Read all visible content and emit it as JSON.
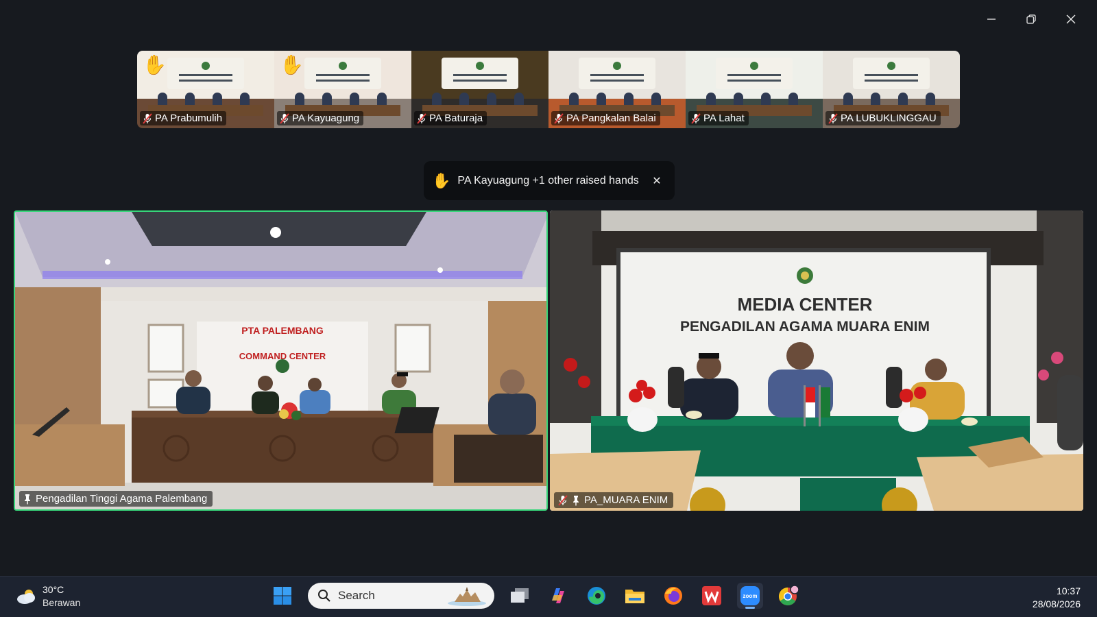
{
  "window_controls": {
    "minimize": "minimize-icon",
    "restore": "restore-icon",
    "close": "close-icon"
  },
  "thumbnails": [
    {
      "name": "PA Prabumulih",
      "hand_raised": true,
      "muted": true,
      "wall": "#f2ede4",
      "floor": "#6b4a36",
      "banner_text": ""
    },
    {
      "name": "PA Kayuagung",
      "hand_raised": true,
      "muted": true,
      "wall": "#efe6dd",
      "floor": "#8a7f77",
      "banner_text": ""
    },
    {
      "name": "PA Baturaja",
      "hand_raised": false,
      "muted": true,
      "wall": "#4a3a20",
      "floor": "#2f2c2a",
      "banner_text": ""
    },
    {
      "name": "PA Pangkalan Balai",
      "hand_raised": false,
      "muted": true,
      "wall": "#e8e4de",
      "floor": "#b85a2d",
      "banner_text": ""
    },
    {
      "name": "PA Lahat",
      "hand_raised": false,
      "muted": true,
      "wall": "#eef0ea",
      "floor": "#3d4a44",
      "banner_text": ""
    },
    {
      "name": "PA LUBUKLINGGAU",
      "hand_raised": false,
      "muted": true,
      "wall": "#e7e3dc",
      "floor": "#7a6a5e",
      "banner_text": ""
    }
  ],
  "toast": {
    "icon": "raised-hand-icon",
    "text": "PA Kayuagung +1 other raised hands",
    "close": "✕"
  },
  "main_tiles": {
    "left": {
      "label": "Pengadilan Tinggi Agama Palembang",
      "pinned": true,
      "muted": false,
      "wall_sign_top": "PTA PALEMBANG",
      "wall_sign_arc": "COMMAND CENTER",
      "active_speaker_color": "#37d67a"
    },
    "right": {
      "label": "PA_MUARA ENIM",
      "pinned": true,
      "muted": true,
      "banner_title": "MEDIA CENTER",
      "banner_subtitle": "PENGADILAN AGAMA MUARA ENIM"
    }
  },
  "taskbar": {
    "weather": {
      "temp": "30°C",
      "condition": "Berawan",
      "icon": "cloud-icon"
    },
    "search_placeholder": "Search",
    "apps": [
      "windows-start-icon",
      "task-view-icon",
      "copilot-icon",
      "edge-icon",
      "file-explorer-icon",
      "firefox-icon",
      "wps-icon",
      "zoom-icon",
      "chrome-icon"
    ],
    "zoom_label": "zoom",
    "time": "10:37",
    "date": "28/08/2026"
  }
}
